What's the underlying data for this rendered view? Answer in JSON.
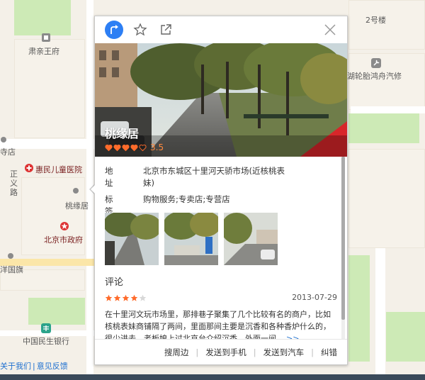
{
  "map": {
    "pois": [
      {
        "name": "肃亲王府",
        "kind": "landmark"
      },
      {
        "name": "2号楼",
        "kind": "building"
      },
      {
        "name": "湖轮胎鸿舟汽修",
        "kind": "repair"
      },
      {
        "name": "寺店",
        "kind": "shop"
      },
      {
        "name": "惠民儿童医院",
        "kind": "hospital"
      },
      {
        "name": "正",
        "kind": "road"
      },
      {
        "name": "义",
        "kind": "road"
      },
      {
        "name": "路",
        "kind": "road"
      },
      {
        "name": "桃缘居",
        "kind": "shop"
      },
      {
        "name": "北京市政府",
        "kind": "government"
      },
      {
        "name": "洋国旗",
        "kind": "building"
      },
      {
        "name": "中国民生银行",
        "kind": "bank"
      }
    ],
    "footer": {
      "about": "关于我们",
      "separator": "|",
      "feedback": "意见反馈"
    }
  },
  "popup": {
    "icons": {
      "nav": "navigation-icon",
      "favorite": "star-icon",
      "share": "share-icon",
      "close": "close-icon"
    },
    "place_name": "桃缘居",
    "rating": {
      "hearts_filled": 4,
      "hearts_total": 5,
      "score": "3.5",
      "color": "#ff6b2b"
    },
    "address": {
      "label": "地址",
      "value": "北京市东城区十里河天骄市场(近核桃表妹)"
    },
    "tags": {
      "label": "标签",
      "value": "购物服务;专卖店;专营店"
    },
    "comments": {
      "heading": "评论",
      "stars_filled": 4,
      "stars_total": 5,
      "date": "2013-07-29",
      "text": "在十里河文玩市场里，那排巷子聚集了几个比较有名的商户，比如核桃表妹商铺隔了两间，里面那间主要是沉香和各种香炉什么的，很少进去，老板娘上过北京台介绍沉香。外面一间...",
      "more": ">>"
    },
    "actions": [
      "搜周边",
      "发送到手机",
      "发送到汽车",
      "纠错"
    ],
    "action_separator": "|"
  },
  "colors": {
    "accent": "#2d7ff4",
    "link": "#1d6fd0",
    "rating": "#ff6b2b",
    "map_bg": "#f4f0e8",
    "green_area": "#cdeab6"
  }
}
